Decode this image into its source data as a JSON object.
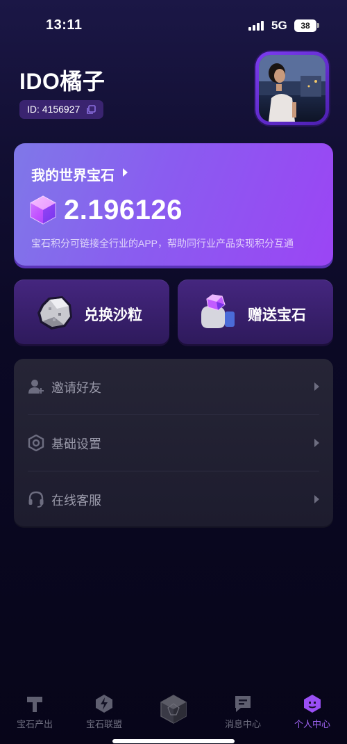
{
  "status_bar": {
    "time": "13:11",
    "network": "5G",
    "battery": "38"
  },
  "profile": {
    "username": "IDO橘子",
    "id_text": "ID: 4156927"
  },
  "gem_card": {
    "title": "我的世界宝石",
    "value": "2.196126",
    "description": "宝石积分可链接全行业的APP，帮助同行业产品实现积分互通"
  },
  "actions": {
    "exchange_label": "兑换沙粒",
    "gift_label": "赠送宝石"
  },
  "menu": [
    {
      "label": "邀请好友",
      "icon": "add-user-icon"
    },
    {
      "label": "基础设置",
      "icon": "settings-hex-icon"
    },
    {
      "label": "在线客服",
      "icon": "headset-icon"
    }
  ],
  "tabs": [
    {
      "label": "宝石产出",
      "icon": "hammer-icon"
    },
    {
      "label": "宝石联盟",
      "icon": "lightning-shield-icon"
    },
    {
      "label": "",
      "icon": "gem-center-icon"
    },
    {
      "label": "消息中心",
      "icon": "message-icon"
    },
    {
      "label": "个人中心",
      "icon": "profile-icon",
      "active": true
    }
  ],
  "colors": {
    "accent": "#a064f5",
    "card_start": "#7f78e8",
    "card_end": "#9b45f4"
  }
}
